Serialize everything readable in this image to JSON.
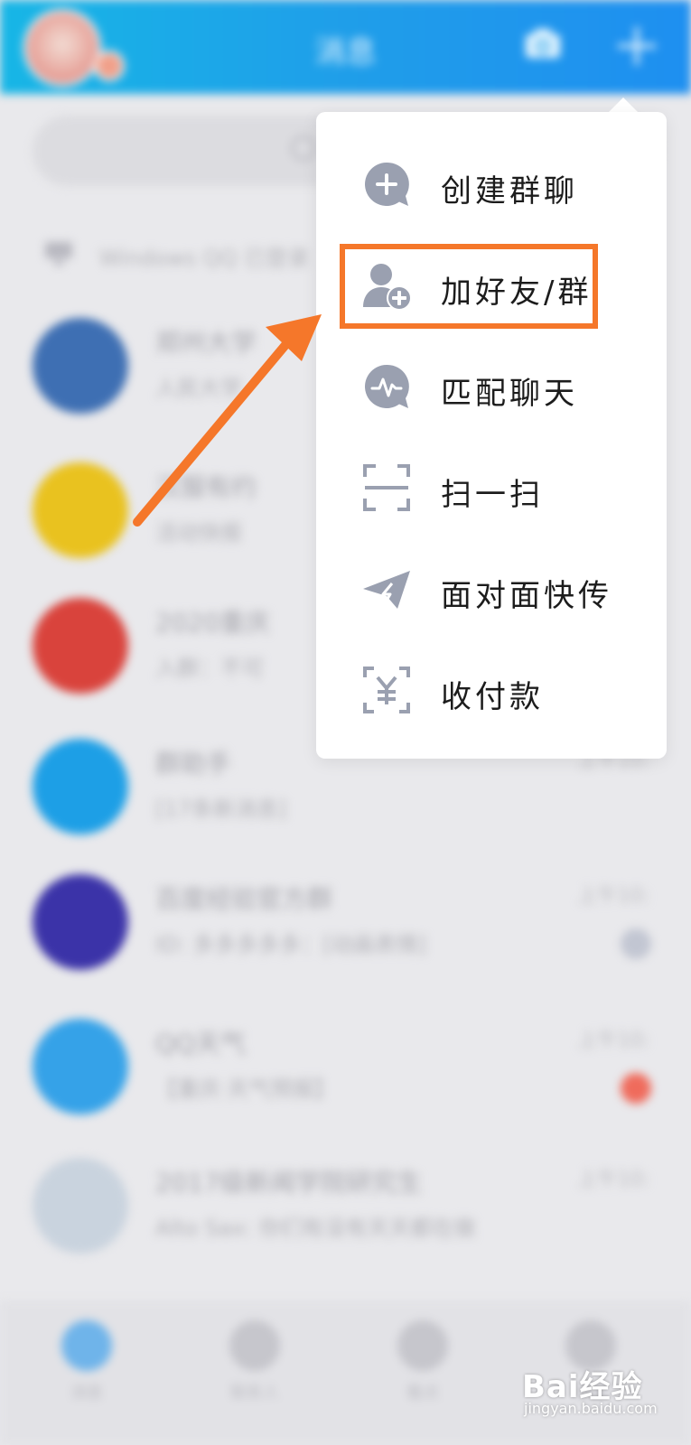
{
  "header": {
    "title": "消息"
  },
  "search": {
    "placeholder": ""
  },
  "notice": {
    "text": "Windows QQ 已登录"
  },
  "conversations": [
    {
      "name": "郑州大学",
      "preview": "人民大学",
      "time": "",
      "avatar_color": "#3e6fb3"
    },
    {
      "name": "汉服有约",
      "preview": "活动快报",
      "time": "",
      "avatar_color": "#e9c21f"
    },
    {
      "name": "2020重庆",
      "preview": "入群：不可",
      "time": "",
      "avatar_color": "#d9433c"
    },
    {
      "name": "群助手",
      "preview": "[17条新消息]",
      "time": "上午10:",
      "avatar_color": "#1d9fe6"
    },
    {
      "name": "百度经验官方群",
      "preview": "ID: 多多多多多：[动画表情]",
      "time": "上午10:",
      "avatar_color": "#3b33a8"
    },
    {
      "name": "QQ天气",
      "preview": "【重庆·天气预报】",
      "time": "上午10:",
      "avatar_color": "#35a2e8"
    },
    {
      "name": "2017级新闻学院研究生",
      "preview": "Alto Sax: 你们有没有天天都在做",
      "time": "上午10:",
      "avatar_color": "#c9d3de"
    }
  ],
  "tabs": [
    {
      "label": "消息"
    },
    {
      "label": "联系人"
    },
    {
      "label": "看点"
    },
    {
      "label": "动态"
    }
  ],
  "menu": {
    "items": [
      {
        "label": "创建群聊",
        "icon": "create-group-icon"
      },
      {
        "label": "加好友/群",
        "icon": "add-friend-icon"
      },
      {
        "label": "匹配聊天",
        "icon": "match-chat-icon"
      },
      {
        "label": "扫一扫",
        "icon": "scan-icon"
      },
      {
        "label": "面对面快传",
        "icon": "face-transfer-icon"
      },
      {
        "label": "收付款",
        "icon": "payment-icon"
      }
    ]
  },
  "watermark": {
    "brand": "Bai经验",
    "url": "jingyan.baidu.com"
  },
  "colors": {
    "header": "#1e9fe8",
    "highlight": "#f5772a",
    "menu_icon": "#9aa0b0"
  }
}
